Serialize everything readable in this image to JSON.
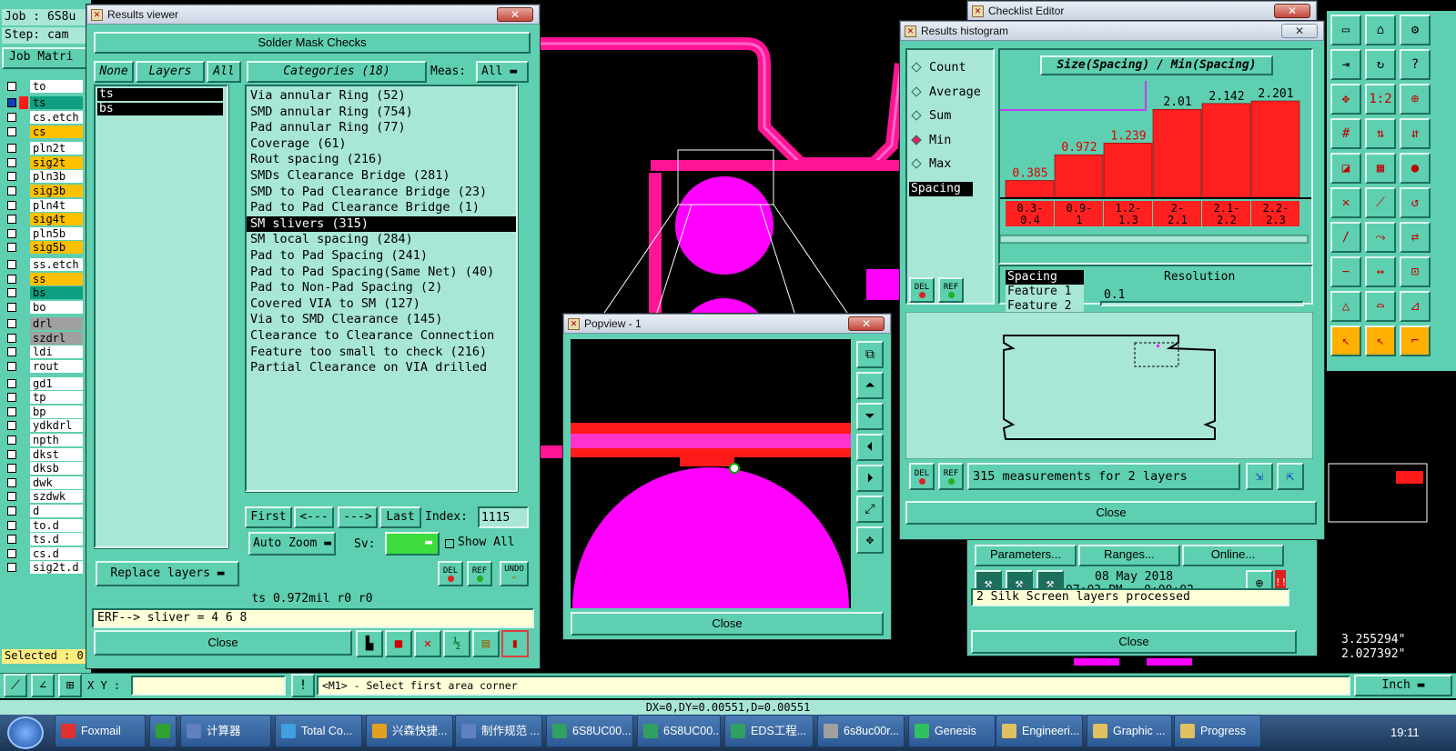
{
  "app": {
    "job_label": "Job : 6S8u",
    "step_label": "Step: cam",
    "job_matrix": "Job Matri"
  },
  "layers": [
    {
      "name": "to",
      "color": "#ffffff"
    },
    {
      "name": "ts",
      "color": "#0ea080"
    },
    {
      "name": "cs.etch",
      "color": "#ffffff"
    },
    {
      "name": "cs",
      "color": "#ffc000"
    },
    {
      "name": "pln2t",
      "color": "#ffffff"
    },
    {
      "name": "sig2t",
      "color": "#ffc000"
    },
    {
      "name": "pln3b",
      "color": "#ffffff"
    },
    {
      "name": "sig3b",
      "color": "#ffc000"
    },
    {
      "name": "pln4t",
      "color": "#ffffff"
    },
    {
      "name": "sig4t",
      "color": "#ffc000"
    },
    {
      "name": "pln5b",
      "color": "#ffffff"
    },
    {
      "name": "sig5b",
      "color": "#ffc000"
    },
    {
      "name": "ss.etch",
      "color": "#ffffff"
    },
    {
      "name": "ss",
      "color": "#ffc000"
    },
    {
      "name": "bs",
      "color": "#0ea080"
    },
    {
      "name": "bo",
      "color": "#ffffff"
    },
    {
      "name": "drl",
      "color": "#a0a0a0"
    },
    {
      "name": "szdrl",
      "color": "#a0a0a0"
    },
    {
      "name": "ldi",
      "color": "#ffffff"
    },
    {
      "name": "rout",
      "color": "#ffffff"
    },
    {
      "name": "gd1",
      "color": "#ffffff"
    },
    {
      "name": "tp",
      "color": "#ffffff"
    },
    {
      "name": "bp",
      "color": "#ffffff"
    },
    {
      "name": "ydkdrl",
      "color": "#ffffff"
    },
    {
      "name": "npth",
      "color": "#ffffff"
    },
    {
      "name": "dkst",
      "color": "#ffffff"
    },
    {
      "name": "dksb",
      "color": "#ffffff"
    },
    {
      "name": "dwk",
      "color": "#ffffff"
    },
    {
      "name": "szdwk",
      "color": "#ffffff"
    },
    {
      "name": "d",
      "color": "#ffffff"
    },
    {
      "name": "to.d",
      "color": "#ffffff"
    },
    {
      "name": "ts.d",
      "color": "#ffffff"
    },
    {
      "name": "cs.d",
      "color": "#ffffff"
    },
    {
      "name": "sig2t.d",
      "color": "#ffffff"
    }
  ],
  "selected_label": "Selected : 0",
  "results_viewer": {
    "title": "Results viewer",
    "header": "Solder Mask Checks",
    "none": "None",
    "layers": "Layers",
    "all": "All",
    "categories_label": "Categories (18)",
    "meas_label": "Meas:",
    "meas_value": "All",
    "layer_list": [
      "ts",
      "bs"
    ],
    "categories": [
      "Via annular Ring (52)",
      "SMD annular Ring (754)",
      "Pad annular Ring (77)",
      "Coverage (61)",
      "Rout spacing (216)",
      "SMDs Clearance Bridge (281)",
      "SMD to Pad Clearance Bridge (23)",
      "Pad to Pad Clearance Bridge (1)",
      "SM slivers (315)",
      "SM local spacing (284)",
      "Pad to Pad Spacing (241)",
      "Pad to Pad Spacing(Same Net) (40)",
      "Pad to Non-Pad Spacing (2)",
      "Covered VIA to SM (127)",
      "Via to SMD Clearance (145)",
      "Clearance to Clearance Connection",
      "Feature too small to check (216)",
      "Partial Clearance on VIA drilled"
    ],
    "selected_category": "SM slivers (315)",
    "first": "First",
    "prev": "<---",
    "next": "--->",
    "last": "Last",
    "index_label": "Index:",
    "index_value": "1115",
    "auto_zoom": "Auto Zoom",
    "sv_label": "Sv:",
    "show_all": "Show All",
    "replace_layers": "Replace layers",
    "del": "DEL",
    "ref": "REF",
    "undo": "UNDO",
    "status_line": "ts 0.972mil  r0  r0",
    "erf_line": "ERF--> sliver = 4 6 8",
    "close": "Close"
  },
  "popview": {
    "title": "Popview - 1",
    "close": "Close"
  },
  "histogram": {
    "title": "Results histogram",
    "heading": "Size(Spacing) / Min(Spacing)",
    "radio": [
      "Count",
      "Average",
      "Sum",
      "Min",
      "Max"
    ],
    "radio_selected": "Min",
    "list_item": "Spacing",
    "options": [
      "Spacing",
      "Feature 1",
      "Feature 2"
    ],
    "resolution_label": "Resolution",
    "resolution_value": "0.1",
    "summary": "315 measurements for 2 layers",
    "close": "Close",
    "del": "DEL",
    "ref": "REF"
  },
  "chart_data": {
    "type": "bar",
    "title": "Size(Spacing) / Min(Spacing)",
    "categories": [
      "0.3-0.4",
      "0.9-1",
      "1.2-1.3",
      "2-2.1",
      "2.1-2.2",
      "2.2-2.3"
    ],
    "category_lines": [
      [
        "0.3-",
        "0.4"
      ],
      [
        "0.9-",
        "1"
      ],
      [
        "1.2-",
        "1.3"
      ],
      [
        "2-",
        "2.1"
      ],
      [
        "2.1-",
        "2.2"
      ],
      [
        "2.2-",
        "2.3"
      ]
    ],
    "values": [
      0.385,
      0.972,
      1.239,
      2.01,
      2.142,
      2.201
    ],
    "value_labels": [
      "0.385",
      "0.972",
      "1.239",
      "2.01",
      "2.142",
      "2.201"
    ],
    "ylim": [
      0,
      2.5
    ],
    "bar_color": "#ff2020",
    "highlighted_label_color": "#e00000"
  },
  "checklist": {
    "title": "Checklist Editor",
    "parameters": "Parameters...",
    "ranges": "Ranges...",
    "online": "Online...",
    "date": "08 May 2018",
    "time": "07:03 PM - 0:00:02",
    "status": "2 Silk Screen layers processed",
    "close": "Close"
  },
  "coords": {
    "x": "3.255294\"",
    "y": "2.027392\""
  },
  "bottom": {
    "xy_label": "X Y :",
    "hint": "<M1> - Select first area corner",
    "unit": "Inch",
    "dx_line": "DX=0,DY=0.00551,D=0.00551"
  },
  "taskbar": {
    "items": [
      "Foxmail",
      "",
      "计算器",
      "Total Co...",
      "兴森快捷...",
      "制作规范 ...",
      "6S8UC00...",
      "6S8UC00...",
      "EDS工程...",
      "6s8uc00r...",
      "Genesis",
      "Engineeri...",
      "Graphic ...",
      "Progress"
    ],
    "clock": "19:11"
  },
  "colors": {
    "teal": "#5ecfb0",
    "light": "#a8e6d6",
    "magenta": "#ff00ff",
    "red": "#ff2020",
    "pink": "#ff1493"
  }
}
